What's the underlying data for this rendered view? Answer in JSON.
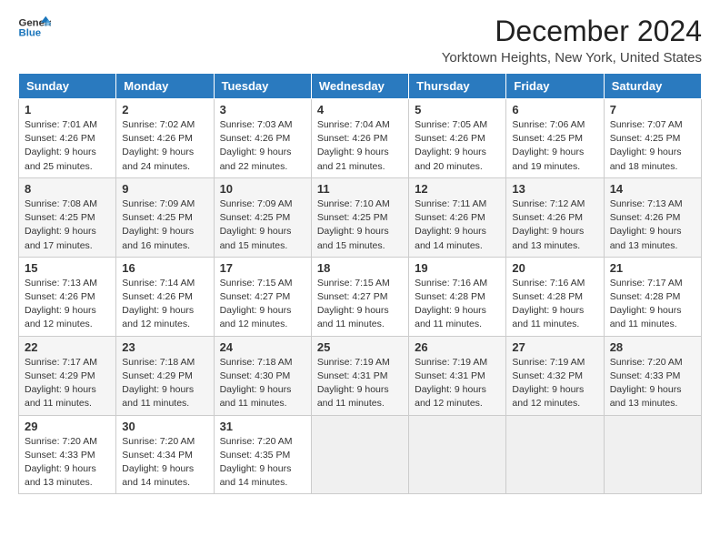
{
  "logo": {
    "line1": "General",
    "line2": "Blue"
  },
  "title": "December 2024",
  "subtitle": "Yorktown Heights, New York, United States",
  "days_of_week": [
    "Sunday",
    "Monday",
    "Tuesday",
    "Wednesday",
    "Thursday",
    "Friday",
    "Saturday"
  ],
  "weeks": [
    [
      {
        "day": "1",
        "sunrise": "Sunrise: 7:01 AM",
        "sunset": "Sunset: 4:26 PM",
        "daylight": "Daylight: 9 hours and 25 minutes."
      },
      {
        "day": "2",
        "sunrise": "Sunrise: 7:02 AM",
        "sunset": "Sunset: 4:26 PM",
        "daylight": "Daylight: 9 hours and 24 minutes."
      },
      {
        "day": "3",
        "sunrise": "Sunrise: 7:03 AM",
        "sunset": "Sunset: 4:26 PM",
        "daylight": "Daylight: 9 hours and 22 minutes."
      },
      {
        "day": "4",
        "sunrise": "Sunrise: 7:04 AM",
        "sunset": "Sunset: 4:26 PM",
        "daylight": "Daylight: 9 hours and 21 minutes."
      },
      {
        "day": "5",
        "sunrise": "Sunrise: 7:05 AM",
        "sunset": "Sunset: 4:26 PM",
        "daylight": "Daylight: 9 hours and 20 minutes."
      },
      {
        "day": "6",
        "sunrise": "Sunrise: 7:06 AM",
        "sunset": "Sunset: 4:25 PM",
        "daylight": "Daylight: 9 hours and 19 minutes."
      },
      {
        "day": "7",
        "sunrise": "Sunrise: 7:07 AM",
        "sunset": "Sunset: 4:25 PM",
        "daylight": "Daylight: 9 hours and 18 minutes."
      }
    ],
    [
      {
        "day": "8",
        "sunrise": "Sunrise: 7:08 AM",
        "sunset": "Sunset: 4:25 PM",
        "daylight": "Daylight: 9 hours and 17 minutes."
      },
      {
        "day": "9",
        "sunrise": "Sunrise: 7:09 AM",
        "sunset": "Sunset: 4:25 PM",
        "daylight": "Daylight: 9 hours and 16 minutes."
      },
      {
        "day": "10",
        "sunrise": "Sunrise: 7:09 AM",
        "sunset": "Sunset: 4:25 PM",
        "daylight": "Daylight: 9 hours and 15 minutes."
      },
      {
        "day": "11",
        "sunrise": "Sunrise: 7:10 AM",
        "sunset": "Sunset: 4:25 PM",
        "daylight": "Daylight: 9 hours and 15 minutes."
      },
      {
        "day": "12",
        "sunrise": "Sunrise: 7:11 AM",
        "sunset": "Sunset: 4:26 PM",
        "daylight": "Daylight: 9 hours and 14 minutes."
      },
      {
        "day": "13",
        "sunrise": "Sunrise: 7:12 AM",
        "sunset": "Sunset: 4:26 PM",
        "daylight": "Daylight: 9 hours and 13 minutes."
      },
      {
        "day": "14",
        "sunrise": "Sunrise: 7:13 AM",
        "sunset": "Sunset: 4:26 PM",
        "daylight": "Daylight: 9 hours and 13 minutes."
      }
    ],
    [
      {
        "day": "15",
        "sunrise": "Sunrise: 7:13 AM",
        "sunset": "Sunset: 4:26 PM",
        "daylight": "Daylight: 9 hours and 12 minutes."
      },
      {
        "day": "16",
        "sunrise": "Sunrise: 7:14 AM",
        "sunset": "Sunset: 4:26 PM",
        "daylight": "Daylight: 9 hours and 12 minutes."
      },
      {
        "day": "17",
        "sunrise": "Sunrise: 7:15 AM",
        "sunset": "Sunset: 4:27 PM",
        "daylight": "Daylight: 9 hours and 12 minutes."
      },
      {
        "day": "18",
        "sunrise": "Sunrise: 7:15 AM",
        "sunset": "Sunset: 4:27 PM",
        "daylight": "Daylight: 9 hours and 11 minutes."
      },
      {
        "day": "19",
        "sunrise": "Sunrise: 7:16 AM",
        "sunset": "Sunset: 4:28 PM",
        "daylight": "Daylight: 9 hours and 11 minutes."
      },
      {
        "day": "20",
        "sunrise": "Sunrise: 7:16 AM",
        "sunset": "Sunset: 4:28 PM",
        "daylight": "Daylight: 9 hours and 11 minutes."
      },
      {
        "day": "21",
        "sunrise": "Sunrise: 7:17 AM",
        "sunset": "Sunset: 4:28 PM",
        "daylight": "Daylight: 9 hours and 11 minutes."
      }
    ],
    [
      {
        "day": "22",
        "sunrise": "Sunrise: 7:17 AM",
        "sunset": "Sunset: 4:29 PM",
        "daylight": "Daylight: 9 hours and 11 minutes."
      },
      {
        "day": "23",
        "sunrise": "Sunrise: 7:18 AM",
        "sunset": "Sunset: 4:29 PM",
        "daylight": "Daylight: 9 hours and 11 minutes."
      },
      {
        "day": "24",
        "sunrise": "Sunrise: 7:18 AM",
        "sunset": "Sunset: 4:30 PM",
        "daylight": "Daylight: 9 hours and 11 minutes."
      },
      {
        "day": "25",
        "sunrise": "Sunrise: 7:19 AM",
        "sunset": "Sunset: 4:31 PM",
        "daylight": "Daylight: 9 hours and 11 minutes."
      },
      {
        "day": "26",
        "sunrise": "Sunrise: 7:19 AM",
        "sunset": "Sunset: 4:31 PM",
        "daylight": "Daylight: 9 hours and 12 minutes."
      },
      {
        "day": "27",
        "sunrise": "Sunrise: 7:19 AM",
        "sunset": "Sunset: 4:32 PM",
        "daylight": "Daylight: 9 hours and 12 minutes."
      },
      {
        "day": "28",
        "sunrise": "Sunrise: 7:20 AM",
        "sunset": "Sunset: 4:33 PM",
        "daylight": "Daylight: 9 hours and 13 minutes."
      }
    ],
    [
      {
        "day": "29",
        "sunrise": "Sunrise: 7:20 AM",
        "sunset": "Sunset: 4:33 PM",
        "daylight": "Daylight: 9 hours and 13 minutes."
      },
      {
        "day": "30",
        "sunrise": "Sunrise: 7:20 AM",
        "sunset": "Sunset: 4:34 PM",
        "daylight": "Daylight: 9 hours and 14 minutes."
      },
      {
        "day": "31",
        "sunrise": "Sunrise: 7:20 AM",
        "sunset": "Sunset: 4:35 PM",
        "daylight": "Daylight: 9 hours and 14 minutes."
      },
      null,
      null,
      null,
      null
    ]
  ],
  "colors": {
    "header_bg": "#2a7abf",
    "header_text": "#ffffff",
    "accent_blue": "#1a75bb"
  }
}
